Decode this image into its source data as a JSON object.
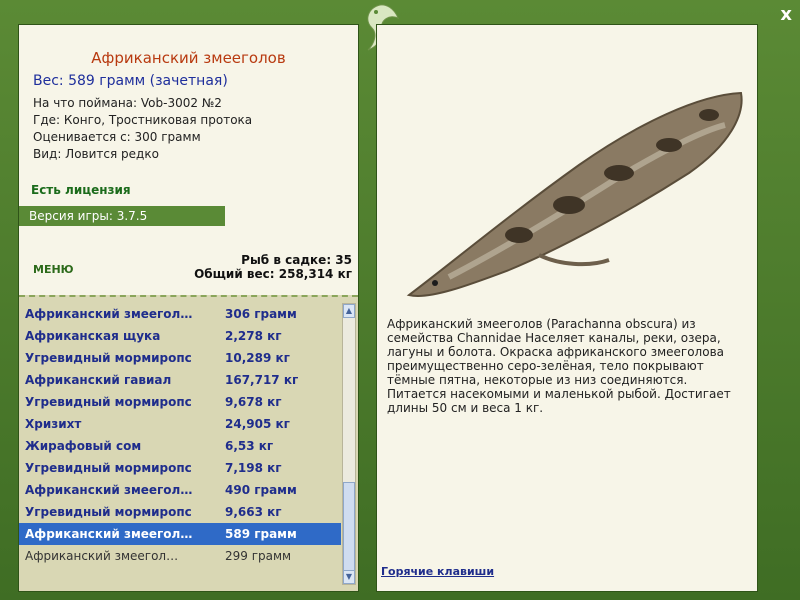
{
  "close_label": "x",
  "fish": {
    "title": "Африканский змееголов",
    "weight": "Вес: 589 грамм (зачетная)",
    "bait": "На что поймана: Vob-3002 №2",
    "place": "Где: Конго, Тростниковая протока",
    "rated": "Оценивается с: 300 грамм",
    "kind": "Вид: Ловится редко",
    "description": "Африканский змееголов (Parachanna obscura) из семейства Channidae Населяет каналы, реки, озера, лагуны и болота. Окраска африканского змееголова преимущественно серо-зелёная, тело покрывают тёмные пятна, некоторые из низ соединяются. Питается насекомыми и маленькой рыбой. Достигает длины 50 см и веса 1 кг."
  },
  "license": "Есть лицензия",
  "version": "Версия игры: 3.7.5",
  "menu_label": "МЕНЮ",
  "cage": {
    "count": "Рыб в садке: 35",
    "total": "Общий вес: 258,314 кг"
  },
  "catch_list": [
    {
      "name": "Африканский змеегол…",
      "weight": "306 грамм"
    },
    {
      "name": "Африканская щука",
      "weight": "2,278 кг"
    },
    {
      "name": "Угревидный мормиропс",
      "weight": "10,289 кг"
    },
    {
      "name": "Африканский гавиал",
      "weight": "167,717 кг"
    },
    {
      "name": "Угревидный мормиропс",
      "weight": "9,678 кг"
    },
    {
      "name": "Хризихт",
      "weight": "24,905 кг"
    },
    {
      "name": "Жирафовый сом",
      "weight": "6,53 кг"
    },
    {
      "name": "Угревидный мормиропс",
      "weight": "7,198 кг"
    },
    {
      "name": "Африканский змеегол…",
      "weight": "490 грамм"
    },
    {
      "name": "Угревидный мормиропс",
      "weight": "9,663 кг"
    },
    {
      "name": "Африканский змеегол…",
      "weight": "589 грамм"
    },
    {
      "name": "Африканский змеегол…",
      "weight": "299 грамм"
    }
  ],
  "hotkeys_label": "Горячие клавиши",
  "colors": {
    "frame": "#4c7a2e",
    "selection": "#2f6ac7",
    "title": "#b83a10"
  }
}
